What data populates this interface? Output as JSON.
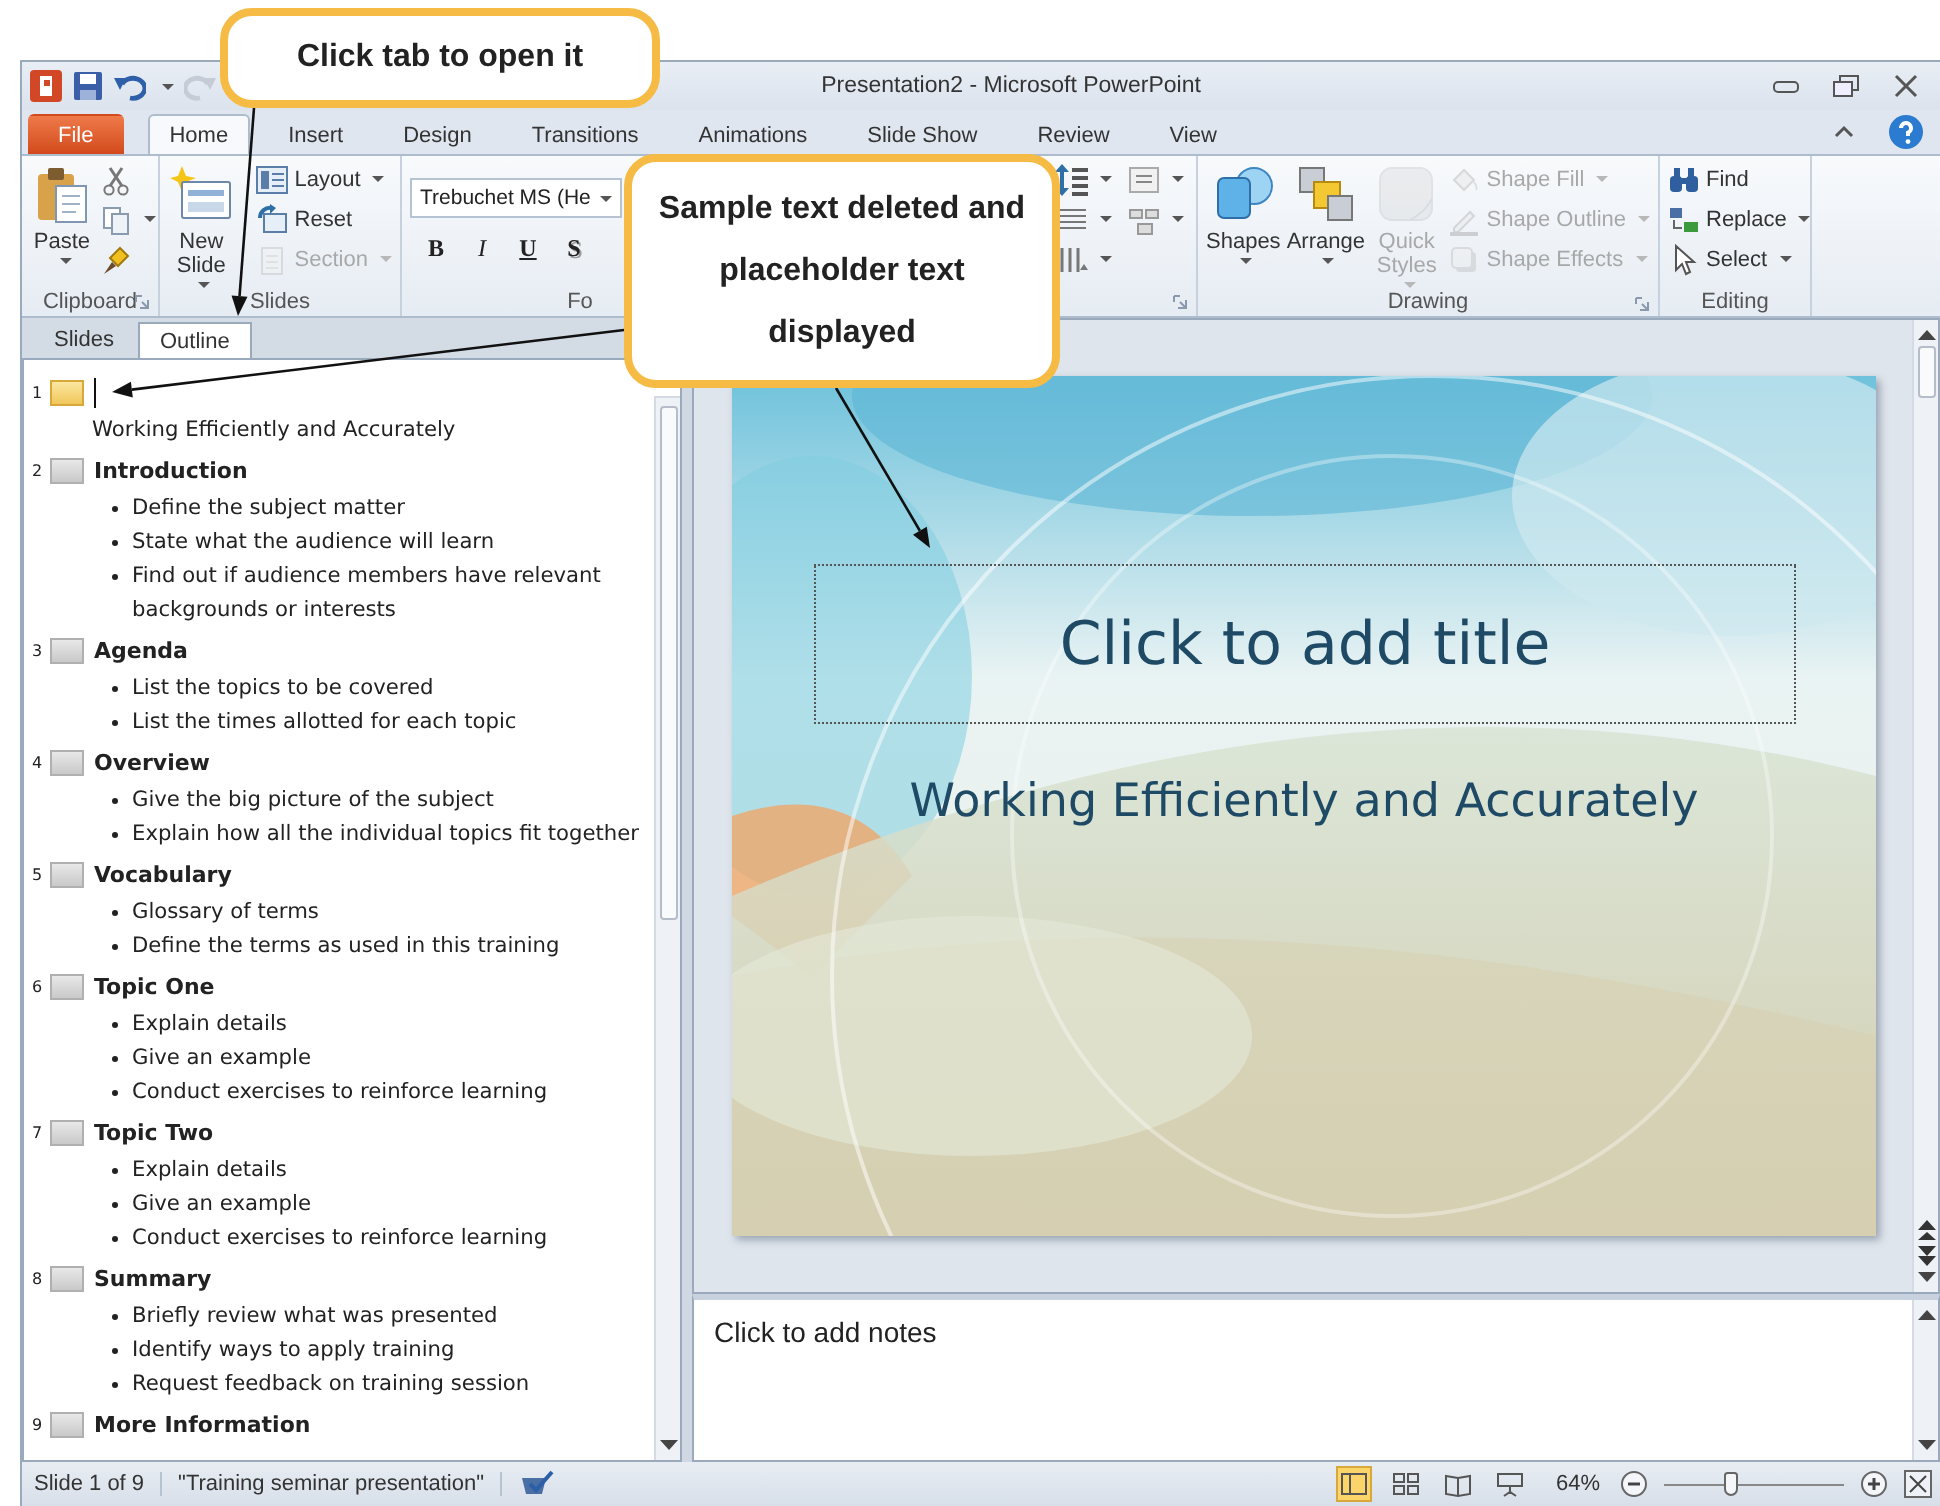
{
  "window": {
    "title": "Presentation2 - Microsoft PowerPoint"
  },
  "ribbon_tabs": [
    {
      "label": "File",
      "kind": "file",
      "selected": false
    },
    {
      "label": "Home",
      "kind": "tab",
      "selected": true
    },
    {
      "label": "Insert",
      "kind": "tab",
      "selected": false
    },
    {
      "label": "Design",
      "kind": "tab",
      "selected": false
    },
    {
      "label": "Transitions",
      "kind": "tab",
      "selected": false
    },
    {
      "label": "Animations",
      "kind": "tab",
      "selected": false
    },
    {
      "label": "Slide Show",
      "kind": "tab",
      "selected": false
    },
    {
      "label": "Review",
      "kind": "tab",
      "selected": false
    },
    {
      "label": "View",
      "kind": "tab",
      "selected": false
    }
  ],
  "ribbon_groups": [
    {
      "label": "Clipboard",
      "launcher": true,
      "items": [
        {
          "kind": "large",
          "label": "Paste",
          "dropdown": true,
          "disabled": false
        },
        {
          "kind": "icon",
          "dropdown": false,
          "disabled": false
        },
        {
          "kind": "icon",
          "dropdown": true,
          "disabled": false
        },
        {
          "kind": "icon",
          "dropdown": false,
          "disabled": false
        }
      ]
    },
    {
      "label": "Slides",
      "launcher": false,
      "items": [
        {
          "kind": "large",
          "label": "New Slide",
          "dropdown": true,
          "disabled": false
        },
        {
          "kind": "small",
          "label": "Layout",
          "dropdown": true,
          "disabled": false
        },
        {
          "kind": "small",
          "label": "Reset",
          "dropdown": false,
          "disabled": false
        },
        {
          "kind": "small",
          "label": "Section",
          "dropdown": true,
          "disabled": true
        }
      ]
    },
    {
      "label": "Fo",
      "launcher": false,
      "items": [
        {
          "kind": "combo",
          "label": "Trebuchet MS (He",
          "dropdown": true,
          "disabled": false
        },
        {
          "kind": "format",
          "label": "B",
          "dropdown": false,
          "disabled": false
        },
        {
          "kind": "format",
          "label": "I",
          "dropdown": false,
          "disabled": false
        },
        {
          "kind": "format",
          "label": "U",
          "dropdown": false,
          "disabled": false
        },
        {
          "kind": "format",
          "label": "S",
          "dropdown": false,
          "disabled": false
        }
      ]
    },
    {
      "launcher": true,
      "items": [
        {
          "kind": "icon",
          "dropdown": true,
          "disabled": false
        },
        {
          "kind": "icon",
          "dropdown": true,
          "disabled": false
        },
        {
          "kind": "icon",
          "dropdown": true,
          "disabled": false
        },
        {
          "kind": "icon",
          "dropdown": true,
          "disabled": false
        },
        {
          "kind": "icon",
          "dropdown": true,
          "disabled": false
        }
      ]
    },
    {
      "label": "Drawing",
      "launcher": true,
      "items": [
        {
          "kind": "large",
          "label": "Shapes",
          "dropdown": true,
          "disabled": false
        },
        {
          "kind": "large",
          "label": "Arrange",
          "dropdown": true,
          "disabled": false
        },
        {
          "kind": "large",
          "label": "Quick Styles",
          "dropdown": true,
          "disabled": true
        },
        {
          "kind": "small",
          "label": "Shape Fill",
          "dropdown": true,
          "disabled": true
        },
        {
          "kind": "small",
          "label": "Shape Outline",
          "dropdown": true,
          "disabled": true
        },
        {
          "kind": "small",
          "label": "Shape Effects",
          "dropdown": true,
          "disabled": true
        }
      ]
    },
    {
      "label": "Editing",
      "launcher": false,
      "items": [
        {
          "kind": "small",
          "label": "Find",
          "dropdown": false,
          "disabled": false
        },
        {
          "kind": "small",
          "label": "Replace",
          "dropdown": true,
          "disabled": false
        },
        {
          "kind": "small",
          "label": "Select",
          "dropdown": true,
          "disabled": false
        }
      ]
    }
  ],
  "pane_tabs": [
    {
      "label": "Slides",
      "selected": false
    },
    {
      "label": "Outline",
      "selected": true
    }
  ],
  "outline": [
    {
      "number": "1",
      "selected": true,
      "editing": true,
      "lines": [
        {
          "kind": "text",
          "text": "Working Efficiently and Accurately"
        }
      ]
    },
    {
      "number": "2",
      "selected": false,
      "editing": false,
      "title": "Introduction",
      "lines": [
        {
          "kind": "bullet",
          "text": "Define the subject matter"
        },
        {
          "kind": "bullet",
          "text": "State what the audience will learn"
        },
        {
          "kind": "bullet",
          "text": "Find out if audience members have relevant backgrounds or interests"
        }
      ]
    },
    {
      "number": "3",
      "selected": false,
      "editing": false,
      "title": "Agenda",
      "lines": [
        {
          "kind": "bullet",
          "text": "List the topics to be covered"
        },
        {
          "kind": "bullet",
          "text": "List the times allotted for each topic"
        }
      ]
    },
    {
      "number": "4",
      "selected": false,
      "editing": false,
      "title": "Overview",
      "lines": [
        {
          "kind": "bullet",
          "text": "Give the big picture of the subject"
        },
        {
          "kind": "bullet",
          "text": "Explain how all the individual topics fit together"
        }
      ]
    },
    {
      "number": "5",
      "selected": false,
      "editing": false,
      "title": "Vocabulary",
      "lines": [
        {
          "kind": "bullet",
          "text": "Glossary of terms"
        },
        {
          "kind": "bullet",
          "text": "Define the terms as used in this training"
        }
      ]
    },
    {
      "number": "6",
      "selected": false,
      "editing": false,
      "title": "Topic One",
      "lines": [
        {
          "kind": "bullet",
          "text": "Explain details"
        },
        {
          "kind": "bullet",
          "text": "Give an example"
        },
        {
          "kind": "bullet",
          "text": "Conduct exercises to reinforce learning"
        }
      ]
    },
    {
      "number": "7",
      "selected": false,
      "editing": false,
      "title": "Topic Two",
      "lines": [
        {
          "kind": "bullet",
          "text": "Explain details"
        },
        {
          "kind": "bullet",
          "text": "Give an example"
        },
        {
          "kind": "bullet",
          "text": "Conduct exercises to reinforce learning"
        }
      ]
    },
    {
      "number": "8",
      "selected": false,
      "editing": false,
      "title": "Summary",
      "lines": [
        {
          "kind": "bullet",
          "text": "Briefly review what was presented"
        },
        {
          "kind": "bullet",
          "text": "Identify ways to apply training"
        },
        {
          "kind": "bullet",
          "text": "Request feedback on training session"
        }
      ]
    },
    {
      "number": "9",
      "selected": false,
      "editing": false,
      "title": "More Information"
    }
  ],
  "slide": {
    "title_placeholder": "Click to add title",
    "subtitle": "Working Efficiently and Accurately"
  },
  "notes": {
    "placeholder": "Click to add notes"
  },
  "status_bar": {
    "slide_info": "Slide 1 of 9",
    "theme": "\"Training seminar presentation\"",
    "views": [
      {
        "selected": true
      },
      {
        "selected": false
      },
      {
        "selected": false
      },
      {
        "selected": false
      }
    ],
    "zoom": {
      "reading": "64%",
      "level": 0.37
    }
  },
  "callouts": [
    {
      "text": "Click tab to open it"
    },
    {
      "text": "Sample text deleted and placeholder text displayed"
    }
  ]
}
